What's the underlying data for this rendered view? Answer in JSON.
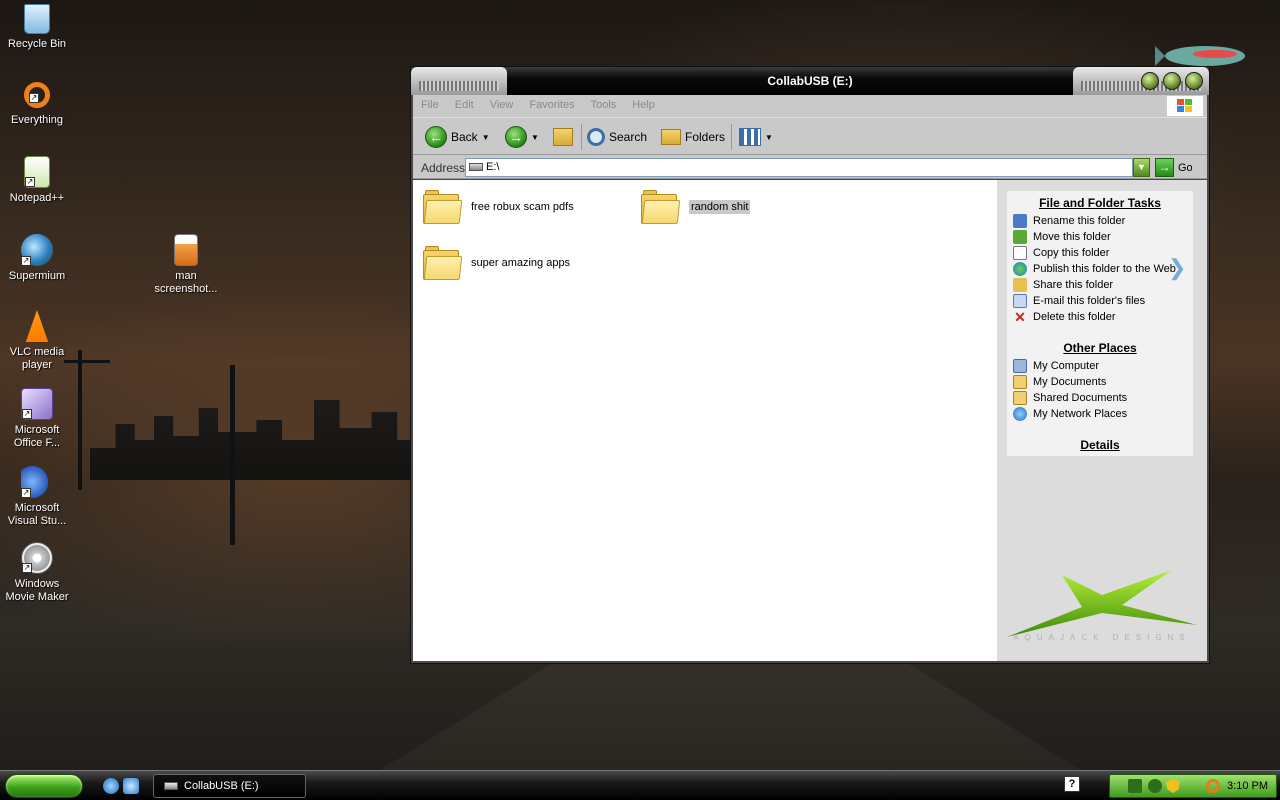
{
  "desktop": {
    "icons": [
      {
        "label": "Recycle Bin",
        "icon": "recycle-bin-icon"
      },
      {
        "label": "Everything",
        "icon": "everything-search-icon"
      },
      {
        "label": "Notepad++",
        "icon": "notepadpp-icon"
      },
      {
        "label": "Supermium",
        "icon": "supermium-browser-icon"
      },
      {
        "label": "VLC media player",
        "icon": "vlc-cone-icon"
      },
      {
        "label": "Microsoft Office F...",
        "icon": "office-icon"
      },
      {
        "label": "Microsoft Visual Stu...",
        "icon": "visual-studio-icon"
      },
      {
        "label": "Windows Movie Maker",
        "icon": "movie-maker-icon"
      },
      {
        "label": "man screenshot...",
        "icon": "image-file-icon"
      }
    ]
  },
  "window": {
    "title": "CollabUSB (E:)",
    "menu": [
      "File",
      "Edit",
      "View",
      "Favorites",
      "Tools",
      "Help"
    ],
    "toolbar": {
      "back_label": "Back",
      "search_label": "Search",
      "folders_label": "Folders"
    },
    "address": {
      "label": "Address",
      "value": "E:\\",
      "go_label": "Go"
    },
    "folders": [
      {
        "name": "free robux scam pdfs",
        "selected": false
      },
      {
        "name": "random shit",
        "selected": true
      },
      {
        "name": "super amazing apps",
        "selected": false
      }
    ],
    "tasks": {
      "file_folder_title": "File and Folder Tasks",
      "file_folder_items": [
        {
          "label": "Rename this folder",
          "icon": "rename-icon"
        },
        {
          "label": "Move this folder",
          "icon": "move-icon"
        },
        {
          "label": "Copy this folder",
          "icon": "copy-icon"
        },
        {
          "label": "Publish this folder to the Web",
          "icon": "publish-web-icon"
        },
        {
          "label": "Share this folder",
          "icon": "share-icon"
        },
        {
          "label": "E-mail this folder's files",
          "icon": "email-icon"
        },
        {
          "label": "Delete this folder",
          "icon": "delete-icon"
        }
      ],
      "other_places_title": "Other Places",
      "other_places_items": [
        {
          "label": "My Computer",
          "icon": "my-computer-icon"
        },
        {
          "label": "My Documents",
          "icon": "my-documents-icon"
        },
        {
          "label": "Shared Documents",
          "icon": "shared-documents-icon"
        },
        {
          "label": "My Network Places",
          "icon": "network-places-icon"
        }
      ],
      "details_title": "Details"
    },
    "watermark": "AQUAJACK DESIGNS"
  },
  "taskbar": {
    "task_button_label": "CollabUSB (E:)",
    "clock": "3:10 PM"
  },
  "colors": {
    "accent_green": "#3ca21a",
    "window_chrome": "#c9c9c9"
  }
}
